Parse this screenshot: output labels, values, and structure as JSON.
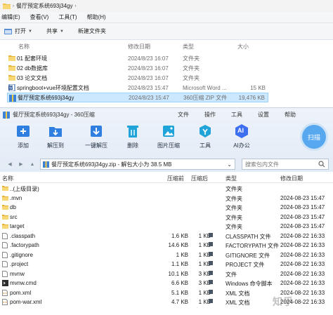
{
  "explorer": {
    "breadcrumb": [
      "餐厅预定系统693j34gy"
    ],
    "menu": [
      "编辑(E)",
      "查看(V)",
      "工具(T)",
      "帮助(H)"
    ],
    "toolbar": {
      "open": "打开",
      "share": "共享",
      "new_folder": "新建文件夹"
    },
    "columns": {
      "name": "名称",
      "date": "修改日期",
      "type": "类型",
      "size": "大小"
    },
    "rows": [
      {
        "name": "01 配套环境",
        "date": "2024/8/23 16:07",
        "type": "文件夹",
        "size": "",
        "icon": "folder-icon"
      },
      {
        "name": "02 db数据库",
        "date": "2024/8/23 16:07",
        "type": "文件夹",
        "size": "",
        "icon": "folder-icon"
      },
      {
        "name": "03 论文文档",
        "date": "2024/8/23 16:07",
        "type": "文件夹",
        "size": "",
        "icon": "folder-icon"
      },
      {
        "name": "springboot+vue环境配置文档",
        "date": "2024/8/23 15:47",
        "type": "Microsoft Word ...",
        "size": "15 KB",
        "icon": "word-icon"
      },
      {
        "name": "餐厅预定系统693j34gy",
        "date": "2024/8/23 15:47",
        "type": "360压缩 ZIP 文件",
        "size": "19,476 KB",
        "icon": "zip-icon"
      }
    ]
  },
  "zip": {
    "title": "餐厅预定系统693j34gy - 360压缩",
    "menus": [
      "文件",
      "操作",
      "工具",
      "设置",
      "帮助"
    ],
    "tools": [
      {
        "label": "添加",
        "icon": "add-icon",
        "color": "#2f7fe0"
      },
      {
        "label": "解压到",
        "icon": "extract-to-icon",
        "color": "#2f7fe0"
      },
      {
        "label": "一键解压",
        "icon": "one-click-extract-icon",
        "color": "#2f7fe0"
      },
      {
        "label": "删除",
        "icon": "delete-icon",
        "color": "#1fa3d8"
      },
      {
        "label": "图片压缩",
        "icon": "image-compress-icon",
        "color": "#1fa3d8"
      },
      {
        "label": "工具",
        "icon": "tools-icon",
        "color": "#1fa3d8"
      },
      {
        "label": "AI办公",
        "icon": "ai-office-icon",
        "color": "#3d6ff0"
      }
    ],
    "ai_badge": "AI",
    "scan_label": "扫描",
    "path_text": "餐厅预定系统693j34gy.zip - 解包大小为 38.5 MB",
    "search_placeholder": "搜索包内文件",
    "columns": {
      "name": "名称",
      "compressed": "压缩前",
      "original": "压缩后",
      "type": "类型",
      "date": "修改日期"
    },
    "rows": [
      {
        "name": "..(上级目录)",
        "cs": "",
        "os": "",
        "type": "文件夹",
        "date": "",
        "icon": "folder-icon"
      },
      {
        "name": ".mvn",
        "cs": "",
        "os": "",
        "type": "文件夹",
        "date": "2024-08-23 15:47",
        "icon": "folder-icon"
      },
      {
        "name": "db",
        "cs": "",
        "os": "",
        "type": "文件夹",
        "date": "2024-08-23 15:47",
        "icon": "folder-icon"
      },
      {
        "name": "src",
        "cs": "",
        "os": "",
        "type": "文件夹",
        "date": "2024-08-23 15:47",
        "icon": "folder-icon"
      },
      {
        "name": "target",
        "cs": "",
        "os": "",
        "type": "文件夹",
        "date": "2024-08-23 15:47",
        "icon": "folder-icon"
      },
      {
        "name": ".classpath",
        "cs": "1.6 KB",
        "os": "1 KB",
        "type": "CLASSPATH 文件",
        "date": "2024-08-22 16:33",
        "icon": "file-icon"
      },
      {
        "name": ".factorypath",
        "cs": "14.6 KB",
        "os": "1 KB",
        "type": "FACTORYPATH 文件",
        "date": "2024-08-22 16:33",
        "icon": "file-icon"
      },
      {
        "name": ".gitignore",
        "cs": "1 KB",
        "os": "1 KB",
        "type": "GITIGNORE 文件",
        "date": "2024-08-22 16:33",
        "icon": "file-icon"
      },
      {
        "name": ".project",
        "cs": "1.1 KB",
        "os": "1 KB",
        "type": "PROJECT 文件",
        "date": "2024-08-22 16:33",
        "icon": "file-icon"
      },
      {
        "name": "mvnw",
        "cs": "10.1 KB",
        "os": "3 KB",
        "type": "文件",
        "date": "2024-08-22 16:33",
        "icon": "file-icon"
      },
      {
        "name": "mvnw.cmd",
        "cs": "6.6 KB",
        "os": "3 KB",
        "type": "Windows 命令脚本",
        "date": "2024-08-22 16:33",
        "icon": "cmd-icon"
      },
      {
        "name": "pom.xml",
        "cs": "5.1 KB",
        "os": "1 KB",
        "type": "XML 文档",
        "date": "2024-08-22 16:33",
        "icon": "xml-icon"
      },
      {
        "name": "pom-war.xml",
        "cs": "4.7 KB",
        "os": "1 KB",
        "type": "XML 文档",
        "date": "2024-08-22 16:33",
        "icon": "xml-icon"
      }
    ]
  },
  "watermark": "知乎"
}
